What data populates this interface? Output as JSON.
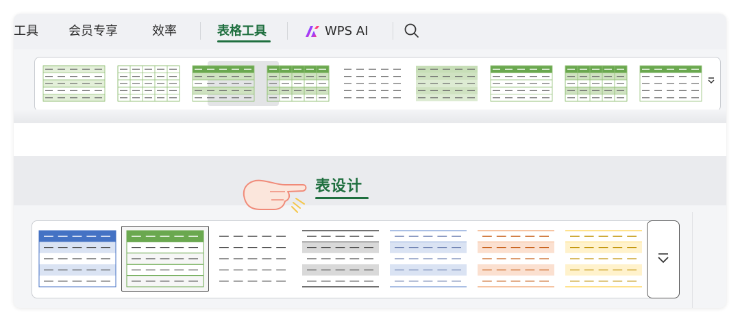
{
  "tabs": [
    {
      "label": "工具",
      "display": "工具"
    },
    {
      "label": "会员专享"
    },
    {
      "label": "效率"
    },
    {
      "label": "表格工具",
      "active": true
    },
    {
      "label": "WPS AI"
    }
  ],
  "design_tab": {
    "label": "表设计"
  },
  "icons": {
    "search": "search-icon",
    "wps_ai_logo": "wps-ai-logo-icon",
    "more": "chevron-down-icon",
    "pointer": "pointing-hand-icon"
  },
  "colors": {
    "accent": "#1f6f3f",
    "green": "#6aa84f",
    "green_light": "#e3efd9",
    "blue": "#4472c4",
    "blue_light": "#dae3f3",
    "gray": "#a6a6a6",
    "orange_light": "#fbe0d0",
    "yellow_light": "#fff2cc"
  },
  "gallery_top": {
    "styles": [
      {
        "name": "light-green-lines",
        "header": "none",
        "band": "light",
        "grid": "horizontal"
      },
      {
        "name": "light-green-grid",
        "header": "none",
        "band": "none",
        "grid": "full"
      },
      {
        "name": "medium-green-selected",
        "header": "green",
        "band": "medium",
        "grid": "horizontal",
        "selected": true
      },
      {
        "name": "green-grid-dark",
        "header": "green",
        "band": "medium",
        "grid": "full"
      },
      {
        "name": "plain-dashes",
        "header": "none",
        "band": "none",
        "grid": "none"
      },
      {
        "name": "green-banded",
        "header": "lightgreen",
        "band": "medium",
        "grid": "none"
      },
      {
        "name": "green-header-rows",
        "header": "green",
        "band": "none",
        "grid": "horizontal"
      },
      {
        "name": "green-grid-bands",
        "header": "green",
        "band": "medium",
        "grid": "full"
      },
      {
        "name": "green-header-light",
        "header": "green",
        "band": "none",
        "grid": "outline"
      }
    ]
  },
  "gallery_bottom": {
    "styles": [
      {
        "name": "blue-banded",
        "color": "blue",
        "selected": false
      },
      {
        "name": "green-banded",
        "color": "green",
        "selected": true
      },
      {
        "name": "plain-none",
        "color": "none",
        "selected": false
      },
      {
        "name": "gray-lines",
        "color": "gray",
        "selected": false
      },
      {
        "name": "blue-light",
        "color": "bluelight",
        "selected": false
      },
      {
        "name": "orange-light",
        "color": "orange",
        "selected": false
      },
      {
        "name": "yellow-light",
        "color": "yellow",
        "selected": false
      }
    ]
  }
}
